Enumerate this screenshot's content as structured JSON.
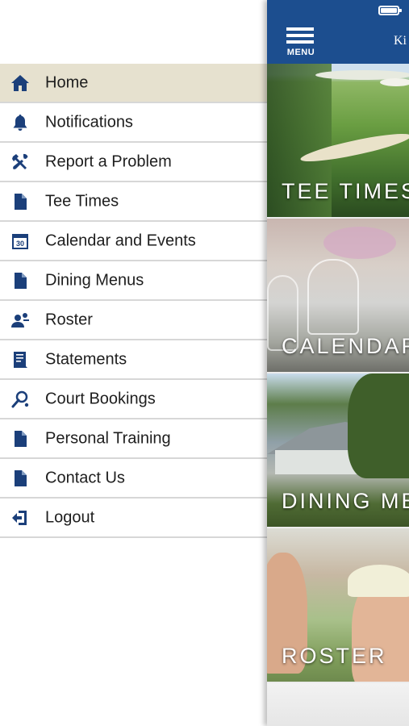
{
  "menu": {
    "items": [
      {
        "label": "Home",
        "icon": "home-icon",
        "active": true
      },
      {
        "label": "Notifications",
        "icon": "bell-icon"
      },
      {
        "label": "Report a Problem",
        "icon": "tools-icon"
      },
      {
        "label": "Tee Times",
        "icon": "document-icon"
      },
      {
        "label": "Calendar and Events",
        "icon": "calendar-icon"
      },
      {
        "label": "Dining Menus",
        "icon": "document-icon"
      },
      {
        "label": "Roster",
        "icon": "roster-icon"
      },
      {
        "label": "Statements",
        "icon": "statement-icon"
      },
      {
        "label": "Court Bookings",
        "icon": "racket-icon"
      },
      {
        "label": "Personal Training",
        "icon": "document-icon"
      },
      {
        "label": "Contact Us",
        "icon": "document-icon"
      },
      {
        "label": "Logout",
        "icon": "logout-icon"
      }
    ]
  },
  "topbar": {
    "menu_label": "MENU",
    "club_name": "Ki"
  },
  "tiles": [
    {
      "label": "TEE TIMES"
    },
    {
      "label": "CALENDAR"
    },
    {
      "label": "DINING ME"
    },
    {
      "label": "ROSTER"
    }
  ],
  "calendar_icon_number": "30",
  "colors": {
    "brand_blue": "#1c4e8f",
    "icon_blue": "#1b3f7a",
    "active_row": "#e6e1cf",
    "divider": "#d7d7d7"
  }
}
